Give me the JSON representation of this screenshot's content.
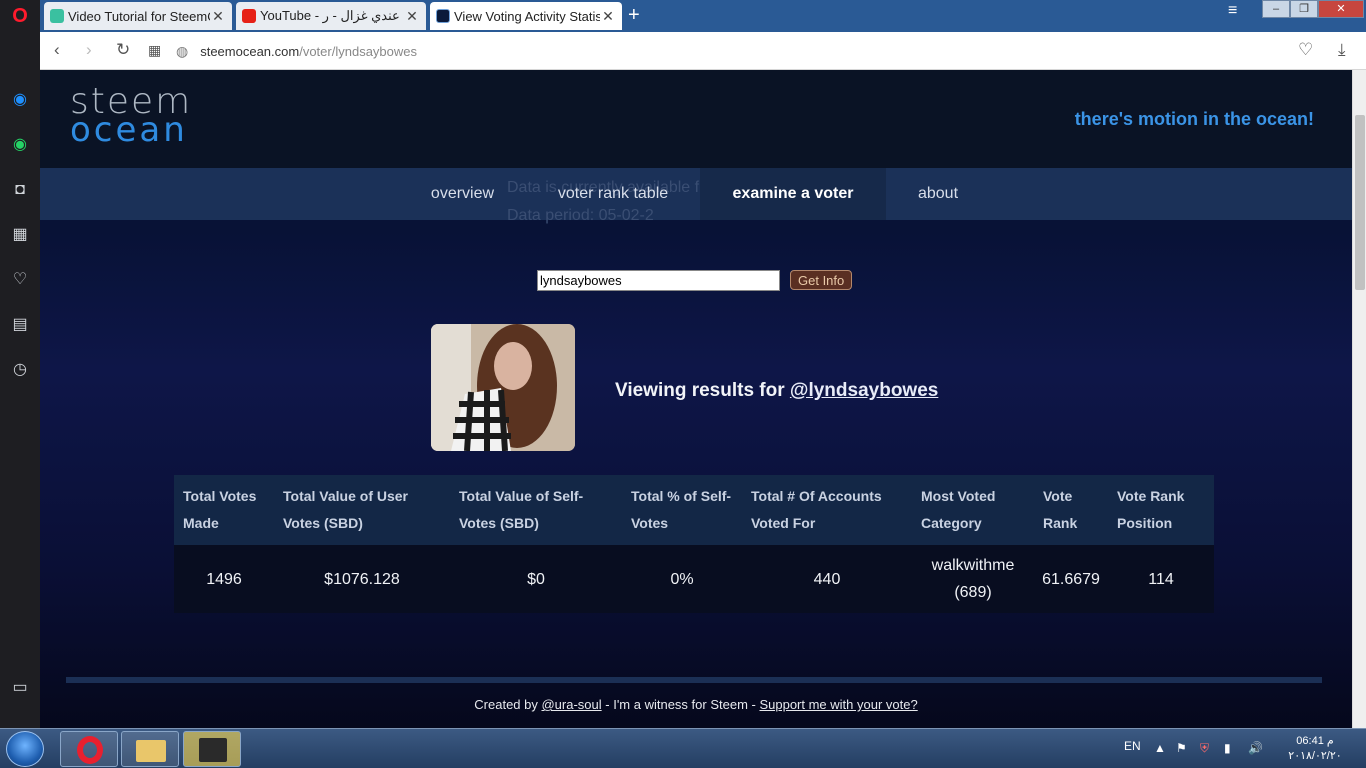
{
  "browser": {
    "tabs": [
      {
        "title": "Video Tutorial for SteemO",
        "active": false
      },
      {
        "title": "YouTube - كان عندي غزال - ر",
        "active": false
      },
      {
        "title": "View Voting Activity Statis",
        "active": true
      }
    ],
    "url_host": "steemocean.com",
    "url_path": "/voter/lyndsaybowes"
  },
  "site": {
    "logo_top": "steem",
    "logo_bottom": "ocean",
    "tagline": "there's motion in the ocean!",
    "nav_ghost_line1": "Data is currently available f",
    "nav_ghost_line2": "Data period: 05-02-2",
    "nav": {
      "overview": "overview",
      "voter_rank_table": "voter rank table",
      "examine_a_voter": "examine a voter",
      "about": "about"
    }
  },
  "search": {
    "value": "lyndsaybowes",
    "button": "Get Info"
  },
  "result": {
    "viewing_prefix": "Viewing results for ",
    "username": "@lyndsaybowes"
  },
  "stats": {
    "headers": [
      "Total Votes Made",
      "Total Value of User Votes (SBD)",
      "Total Value of Self-Votes (SBD)",
      "Total % of Self-Votes",
      "Total # Of Accounts Voted For",
      "Most Voted Category",
      "Vote Rank",
      "Vote Rank Position"
    ],
    "row": [
      "1496",
      "$1076.128",
      "$0",
      "0%",
      "440",
      "walkwithme (689)",
      "61.6679",
      "114"
    ]
  },
  "footer": {
    "prefix": "Created by ",
    "author": "@ura-soul",
    "middle": " - I'm a witness for Steem - ",
    "link": "Support me with your vote?"
  },
  "taskbar": {
    "lang": "EN",
    "time": "06:41 م",
    "date": "٢٠١٨/٠٢/٢٠"
  }
}
